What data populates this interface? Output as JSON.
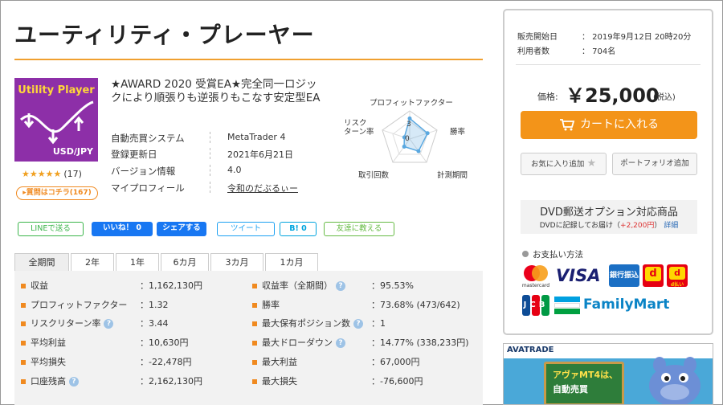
{
  "title": "ユーティリティ・プレーヤー",
  "product_image": {
    "title": "Utility Player",
    "pair": "USD/JPY"
  },
  "rating": {
    "stars": "★★★★★",
    "count": "(17)"
  },
  "qa_button": "▸質問はコチラ(167)",
  "description": "★AWARD 2020 受賞EA★完全同一ロジックにより順張りも逆張りもこなす安定型EA",
  "specs": [
    {
      "label": "自動売買システム",
      "value": "MetaTrader 4"
    },
    {
      "label": "登録更新日",
      "value": "2021年6月21日"
    },
    {
      "label": "バージョン情報",
      "value": "4.0"
    },
    {
      "label": "マイプロフィール",
      "value": "令和のだぶるぃー"
    }
  ],
  "radar": {
    "labels": {
      "pf": "プロフィットファクター",
      "win": "勝率",
      "period": "計測期間",
      "trades": "取引回数",
      "risk": "リスク\nターン率"
    },
    "scale_label_3": "3",
    "scale_label_0": "0",
    "values": [
      2.2,
      2.0,
      1.6,
      1.0,
      0.6
    ],
    "max": 3
  },
  "social": {
    "line": "LINEで送る",
    "like": "いいね！ 0",
    "share": "シェアする",
    "tweet": "ツイート",
    "hatena": "B! 0",
    "friend": "友達に教える"
  },
  "tabs": [
    "全期間",
    "2年",
    "1年",
    "6カ月",
    "3カ月",
    "1カ月"
  ],
  "stats_left": [
    {
      "label": "収益",
      "value": "：1,162,130円",
      "help": false
    },
    {
      "label": "プロフィットファクター",
      "value": "：1.32",
      "help": false
    },
    {
      "label": "リスクリターン率",
      "value": "：3.44",
      "help": true
    },
    {
      "label": "平均利益",
      "value": "：10,630円",
      "help": false
    },
    {
      "label": "平均損失",
      "value": "：-22,478円",
      "help": false
    },
    {
      "label": "口座残高",
      "value": "：2,162,130円",
      "help": true
    }
  ],
  "stats_right": [
    {
      "label": "収益率（全期間）",
      "value": "：95.53%",
      "help": true
    },
    {
      "label": "勝率",
      "value": "：73.68% (473/642)",
      "help": false
    },
    {
      "label": "最大保有ポジション数",
      "value": "：1",
      "help": true
    },
    {
      "label": "最大ドローダウン",
      "value": "：14.77% (338,233円)",
      "help": true
    },
    {
      "label": "最大利益",
      "value": "：67,000円",
      "help": false
    },
    {
      "label": "最大損失",
      "value": "：-76,600円",
      "help": false
    }
  ],
  "help_glyph": "?",
  "sidebar": {
    "sale_start_label": "販売開始日",
    "sale_start_value": "：  2019年9月12日 20時20分",
    "users_label": "利用者数",
    "users_value": "：  704名",
    "price_label": "価格:",
    "price": "￥25,000",
    "tax": "(税込)",
    "cart_button": "カートに入れる",
    "favorite_button": "お気に入り追加",
    "portfolio_button": "ポートフォリオ追加",
    "dvd_title": "DVD郵送オプション対応商品",
    "dvd_note_prefix": "DVDに記録してお届け（",
    "dvd_note_price": "+2,200円",
    "dvd_note_suffix": "）",
    "dvd_detail_link": "詳細",
    "payment_title": "お支払い方法",
    "payments": {
      "mastercard": "mastercard",
      "visa": "VISA",
      "bank": "銀行振込",
      "docomo": "d払い",
      "dbarai": "d",
      "jcb": "JCB",
      "familymart": "FamilyMart"
    }
  },
  "ad": {
    "logo": "AVATRADE",
    "line1": "アヴァMT4は、",
    "line2": "自動売買"
  },
  "colors": {
    "accent_orange": "#f39419",
    "title_rule": "#f0a030",
    "product_purple": "#8d2fa8",
    "facebook_blue": "#1877f2",
    "radar_blue": "#5aa8e0"
  }
}
